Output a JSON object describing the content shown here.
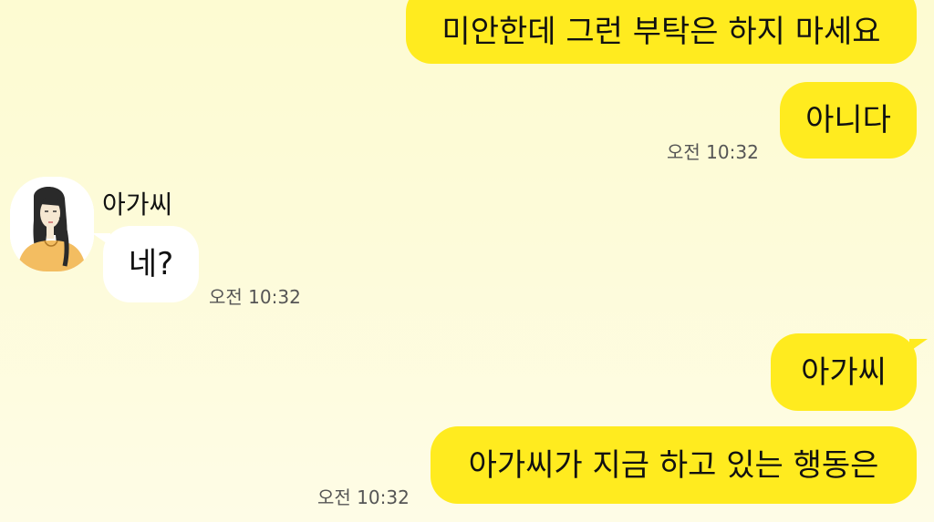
{
  "messages": {
    "m1": {
      "text": "미안한데 그런 부탁은 하지 마세요"
    },
    "m2": {
      "text": "아니다",
      "time": "오전 10:32"
    },
    "m3": {
      "sender": "아가씨",
      "text": "네?",
      "time": "오전 10:32"
    },
    "m4": {
      "text": "아가씨"
    },
    "m5": {
      "text": "아가씨가 지금 하고 있는 행동은",
      "time": "오전 10:32"
    }
  },
  "avatar": {
    "icon": "woman-portrait-avatar"
  },
  "colors": {
    "outgoing_bubble": "#ffeb1f",
    "incoming_bubble": "#ffffff",
    "background": "#fdfbd2"
  }
}
